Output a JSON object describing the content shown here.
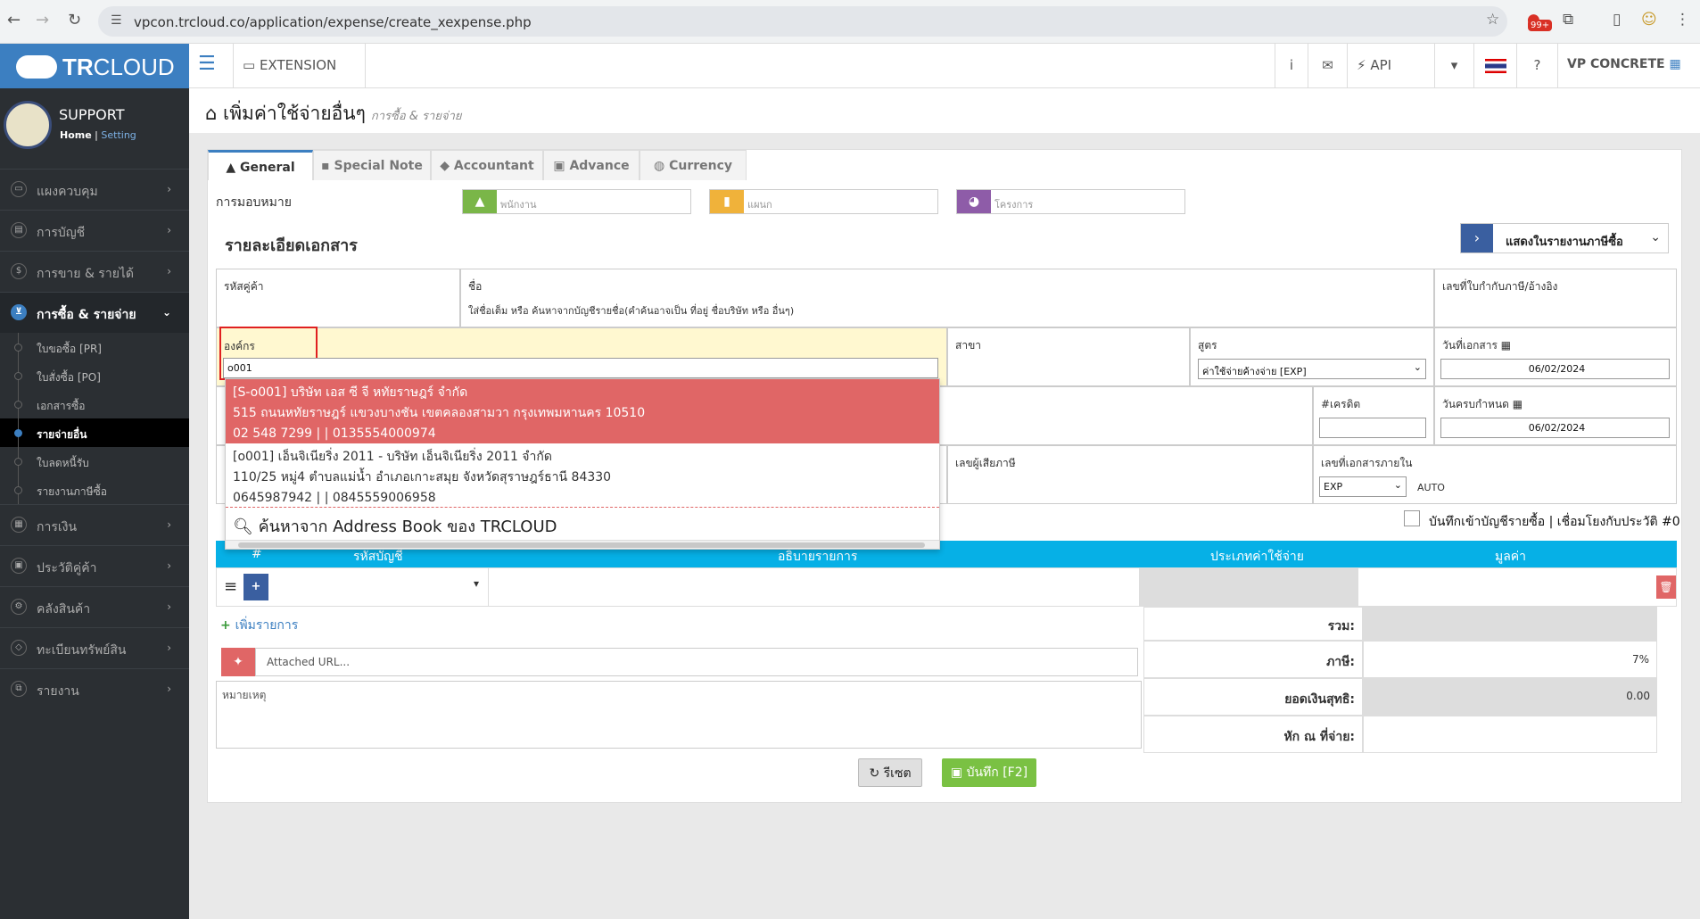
{
  "browser": {
    "url": "vpcon.trcloud.co/application/expense/create_xexpense.php",
    "badge": "99+"
  },
  "sidebar": {
    "logo_bold": "TR",
    "logo_light": "CLOUD",
    "user": "SUPPORT",
    "home": "Home",
    "setting": "Setting",
    "items": [
      {
        "label": "แผงควบคุม",
        "icon": "monitor-icon"
      },
      {
        "label": "การบัญชี",
        "icon": "book-icon"
      },
      {
        "label": "การขาย & รายได้",
        "icon": "dollar-icon"
      },
      {
        "label": "การซื้อ & รายจ่าย",
        "icon": "cart-icon"
      }
    ],
    "sub": [
      "ใบขอซื้อ [PR]",
      "ใบสั่งซื้อ [PO]",
      "เอกสารซื้อ",
      "รายจ่ายอื่น",
      "ใบลดหนี้รับ",
      "รายงานภาษีซื้อ"
    ],
    "items2": [
      {
        "label": "การเงิน",
        "icon": "calendar-icon"
      },
      {
        "label": "ประวัติคู่ค้า",
        "icon": "contact-icon"
      },
      {
        "label": "คลังสินค้า",
        "icon": "box-icon"
      },
      {
        "label": "ทะเบียนทรัพย์สิน",
        "icon": "diamond-icon"
      },
      {
        "label": "รายงาน",
        "icon": "copy-icon"
      }
    ]
  },
  "topbar": {
    "extension": "EXTENSION",
    "api": "API",
    "company": "VP CONCRETE"
  },
  "page": {
    "title": "เพิ่มค่าใช้จ่ายอื่นๆ",
    "breadcrumb": "การซื้อ & รายจ่าย"
  },
  "tabs": [
    "General",
    "Special Note",
    "Accountant",
    "Advance",
    "Currency"
  ],
  "assign": {
    "label": "การมอบหมาย",
    "employee": "พนักงาน",
    "department": "แผนก",
    "project": "โครงการ"
  },
  "doc": {
    "heading": "รายละเอียดเอกสาร",
    "report_select": "แสดงในรายงานภาษีซื้อ"
  },
  "fields": {
    "vendor_code": "รหัสคู่ค้า",
    "name": "ชื่อ",
    "name_hint": "ใส่ชื่อเต็ม หรือ ค้นหาจากบัญชีรายชื่อ(คำค้นอาจเป็น ที่อยู่ ชื่อบริษัท หรือ อื่นๆ)",
    "tax_ref": "เลขที่ใบกำกับภาษี/อ้างอิง",
    "org": "องค์กร",
    "org_value": "o001",
    "branch": "สาขา",
    "formula": "สูตร",
    "formula_value": "ค่าใช้จ่ายค้างจ่าย [EXP]",
    "doc_date": "วันที่เอกสาร",
    "doc_date_value": "06/02/2024",
    "credit": "#เครดิต",
    "due": "วันครบกำหนด",
    "due_value": "06/02/2024",
    "taxpayer": "เลขผู้เสียภาษี",
    "internal_no": "เลขที่เอกสารภายใน",
    "internal_prefix": "EXP",
    "auto": "AUTO"
  },
  "dropdown": {
    "options": [
      {
        "l1": "[S-o001] บริษัท เอส ซี จี หทัยราษฎร์ จำกัด",
        "l2": "515 ถนนหทัยราษฎร์ แขวงบางชัน เขตคลองสามวา กรุงเทพมหานคร 10510",
        "l3": "02 548 7299 | | 0135554000974"
      },
      {
        "l1": "[o001] เอ็นจิเนียริ่ง 2011 - บริษัท เอ็นจิเนียริ่ง 2011 จำกัด",
        "l2": "110/25 หมู่4 ตำบลแม่น้ำ อำเภอเกาะสมุย จังหวัดสุราษฎร์ธานี 84330",
        "l3": "0645987942 | | 0845559006958"
      }
    ],
    "search": "ค้นหาจาก Address Book ของ TRCLOUD"
  },
  "ledger": "บันทึกเข้าบัญชีรายซื้อ | เชื่อมโยงกับประวัติ #0",
  "table": {
    "cols": [
      "#",
      "รหัสบัญชี",
      "อธิบายรายการ",
      "ประเภทค่าใช้จ่าย",
      "มูลค่า"
    ],
    "add_row": "เพิ่มรายการ"
  },
  "summary": {
    "total": "รวม:",
    "tax": "ภาษี:",
    "tax_value": "7%",
    "net": "ยอดเงินสุทธิ:",
    "net_value": "0.00",
    "wht": "หัก ณ ที่จ่าย:"
  },
  "attach_placeholder": "Attached URL...",
  "note": "หมายเหตุ",
  "buttons": {
    "reset": "รีเซต",
    "save": "บันทึก [F2]"
  }
}
